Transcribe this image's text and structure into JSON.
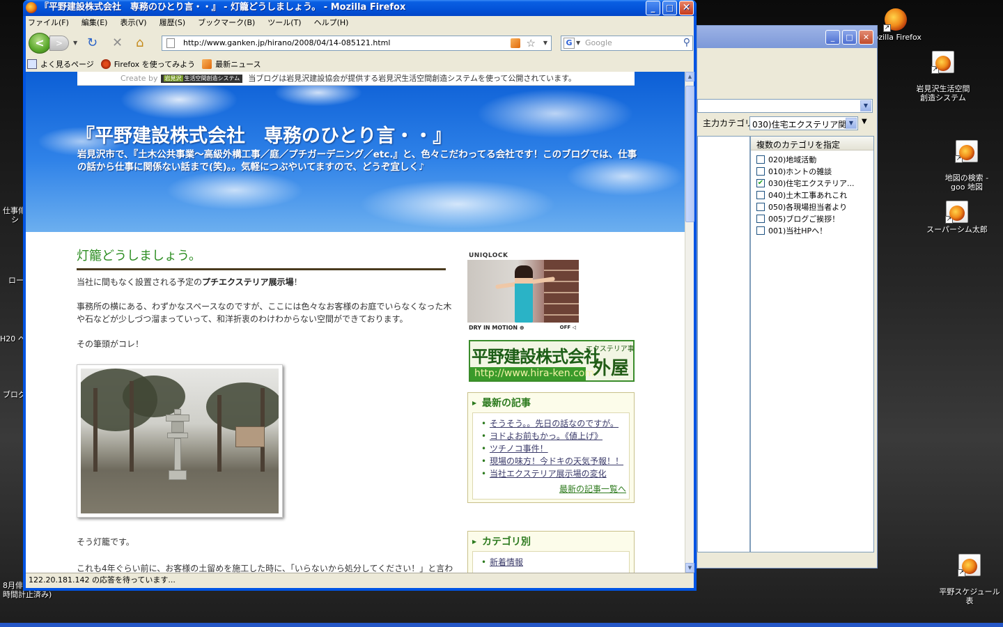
{
  "desktop": {
    "icons": [
      {
        "name": "firefox-shortcut",
        "label": "Mozilla Firefox",
        "icon": "firefox-icon"
      },
      {
        "name": "iwamizawa-shortcut",
        "label": "岩見沢生活空間\n創造システム",
        "icon": "firefox-doc-icon"
      },
      {
        "name": "chizu-shortcut",
        "label": "地図の検索 -\ngoo 地図",
        "icon": "firefox-doc-icon"
      },
      {
        "name": "supersim-shortcut",
        "label": "スーパーシム太郎",
        "icon": "firefox-doc-icon"
      },
      {
        "name": "schedule-shortcut",
        "label": "平野スケジュール\n表",
        "icon": "firefox-doc-icon"
      }
    ],
    "left_edge_labels": [
      "仕事俳",
      "シ",
      "ロー",
      "H20 ヘ",
      "ブログ",
      "8月俳",
      "時間計止済み)"
    ]
  },
  "bg_window": {
    "category_label": "主力カテゴリ:",
    "category_value": "030)住宅エクステリア関",
    "multi_header": "複数のカテゴリを指定",
    "categories": [
      {
        "label": "020)地域活動",
        "checked": false
      },
      {
        "label": "010)ホントの雑談",
        "checked": false
      },
      {
        "label": "030)住宅エクステリア...",
        "checked": true
      },
      {
        "label": "040)土木工事あれこれ",
        "checked": false
      },
      {
        "label": "050)各現場担当者より",
        "checked": false
      },
      {
        "label": "005)ブログご挨拶！",
        "checked": false
      },
      {
        "label": "001)当社HPへ！",
        "checked": false
      }
    ]
  },
  "browser": {
    "window_title": "『平野建設株式会社　専務のひとり言・・』 - 灯籠どうしましょう。 - Mozilla Firefox",
    "menu": [
      "ファイル(F)",
      "編集(E)",
      "表示(V)",
      "履歴(S)",
      "ブックマーク(B)",
      "ツール(T)",
      "ヘルプ(H)"
    ],
    "url": "http://www.ganken.jp/hirano/2008/04/14-085121.html",
    "search_placeholder": "Google",
    "bookmarks": [
      "よく見るページ",
      "Firefox を使ってみよう",
      "最新ニュース"
    ],
    "status": "122.20.181.142 の応答を待っています..."
  },
  "page": {
    "create_by": "Create by",
    "create_logo_a": "岩見沢",
    "create_logo_b": "生活空間創造システム",
    "create_notice": "当ブログは岩見沢建設協会が提供する岩見沢生活空間創造システムを使って公開されています。",
    "blog_title": "『平野建設株式会社　専務のひとり言・・』",
    "blog_description": "岩見沢市で、『土木公共事業～高級外構工事／庭／プチガーデニング／etc.』と、色々こだわってる会社です！このブログでは、仕事の話から仕事に関係ない話まで(笑)。。気軽につぶやいてますので、どうぞ宜しく♪",
    "post_title": "灯籠どうしましょう。",
    "p1_pre": "当社に間もなく設置される予定の",
    "p1_strong": "プチエクステリア展示場",
    "p1_post": "！",
    "p2": "事務所の横にある、わずかなスペースなのですが、ここには色々なお客様のお庭でいらなくなった木や石などが少しづつ溜まっていって、和洋折衷のわけわからない空間ができております。",
    "p3": "その筆頭がコレ！",
    "p4": "そう灯籠です。",
    "p5": "これも4年ぐらい前に、お客様の土留めを施工した時に、「いらないから処分してください！」と言わ",
    "uniqlock_label": "UNIQLOCK",
    "uniqlock_caption": "DRY IN MOTION ⊕",
    "uniqlock_sound": "OFF",
    "banner_company": "平野建設株式会社",
    "banner_dept": "エクステリア事業部",
    "banner_brand": "外屋",
    "banner_url": "http://www.hira-ken.com",
    "recent_heading": "最新の記事",
    "recent_posts": [
      "そうそう。。先日の話なのですが。",
      "ヨドよお前もかっ。《値上げ》",
      "ツチノコ事件！",
      "現場の味方！今ドキの天気予報！！",
      "当社エクステリア展示場の変化"
    ],
    "recent_more": "最新の記事一覧へ",
    "category_heading": "カテゴリ別",
    "category_items": [
      "新着情報"
    ]
  }
}
